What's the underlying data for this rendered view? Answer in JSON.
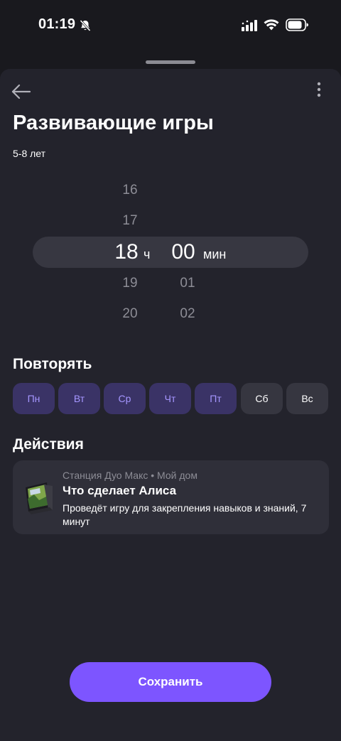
{
  "status_bar": {
    "time": "01:19",
    "icons": [
      "bell-off-icon",
      "signal-icon",
      "wifi-icon",
      "battery-icon"
    ]
  },
  "header": {
    "back_icon": "arrow-left-icon",
    "more_icon": "more-vertical-icon",
    "title": "Развивающие игры",
    "subtitle": "5-8 лет"
  },
  "time_picker": {
    "hours_above": [
      "16",
      "17"
    ],
    "hour_selected": "18",
    "hours_below": [
      "19",
      "20"
    ],
    "hour_unit": "ч",
    "minute_selected": "00",
    "minutes_below": [
      "01",
      "02"
    ],
    "minute_unit": "мин"
  },
  "repeat": {
    "title": "Повторять",
    "days": [
      {
        "label": "Пн",
        "selected": true
      },
      {
        "label": "Вт",
        "selected": true
      },
      {
        "label": "Ср",
        "selected": true
      },
      {
        "label": "Чт",
        "selected": true
      },
      {
        "label": "Пт",
        "selected": true
      },
      {
        "label": "Сб",
        "selected": false
      },
      {
        "label": "Вс",
        "selected": false
      }
    ]
  },
  "actions": {
    "title": "Действия",
    "items": [
      {
        "device": "Станция Дуо Макс",
        "separator": "•",
        "home": "Мой дом",
        "meta": "Станция Дуо Макс • Мой дом",
        "title": "Что сделает Алиса",
        "description": "Проведёт игру для закрепления навыков и знаний, 7 минут"
      }
    ]
  },
  "footer": {
    "save_label": "Сохранить"
  },
  "colors": {
    "background": "#19191e",
    "sheet": "#23232c",
    "accent": "#7d55ff",
    "day_selected_bg": "#3a3366",
    "day_selected_text": "#a596ff"
  }
}
